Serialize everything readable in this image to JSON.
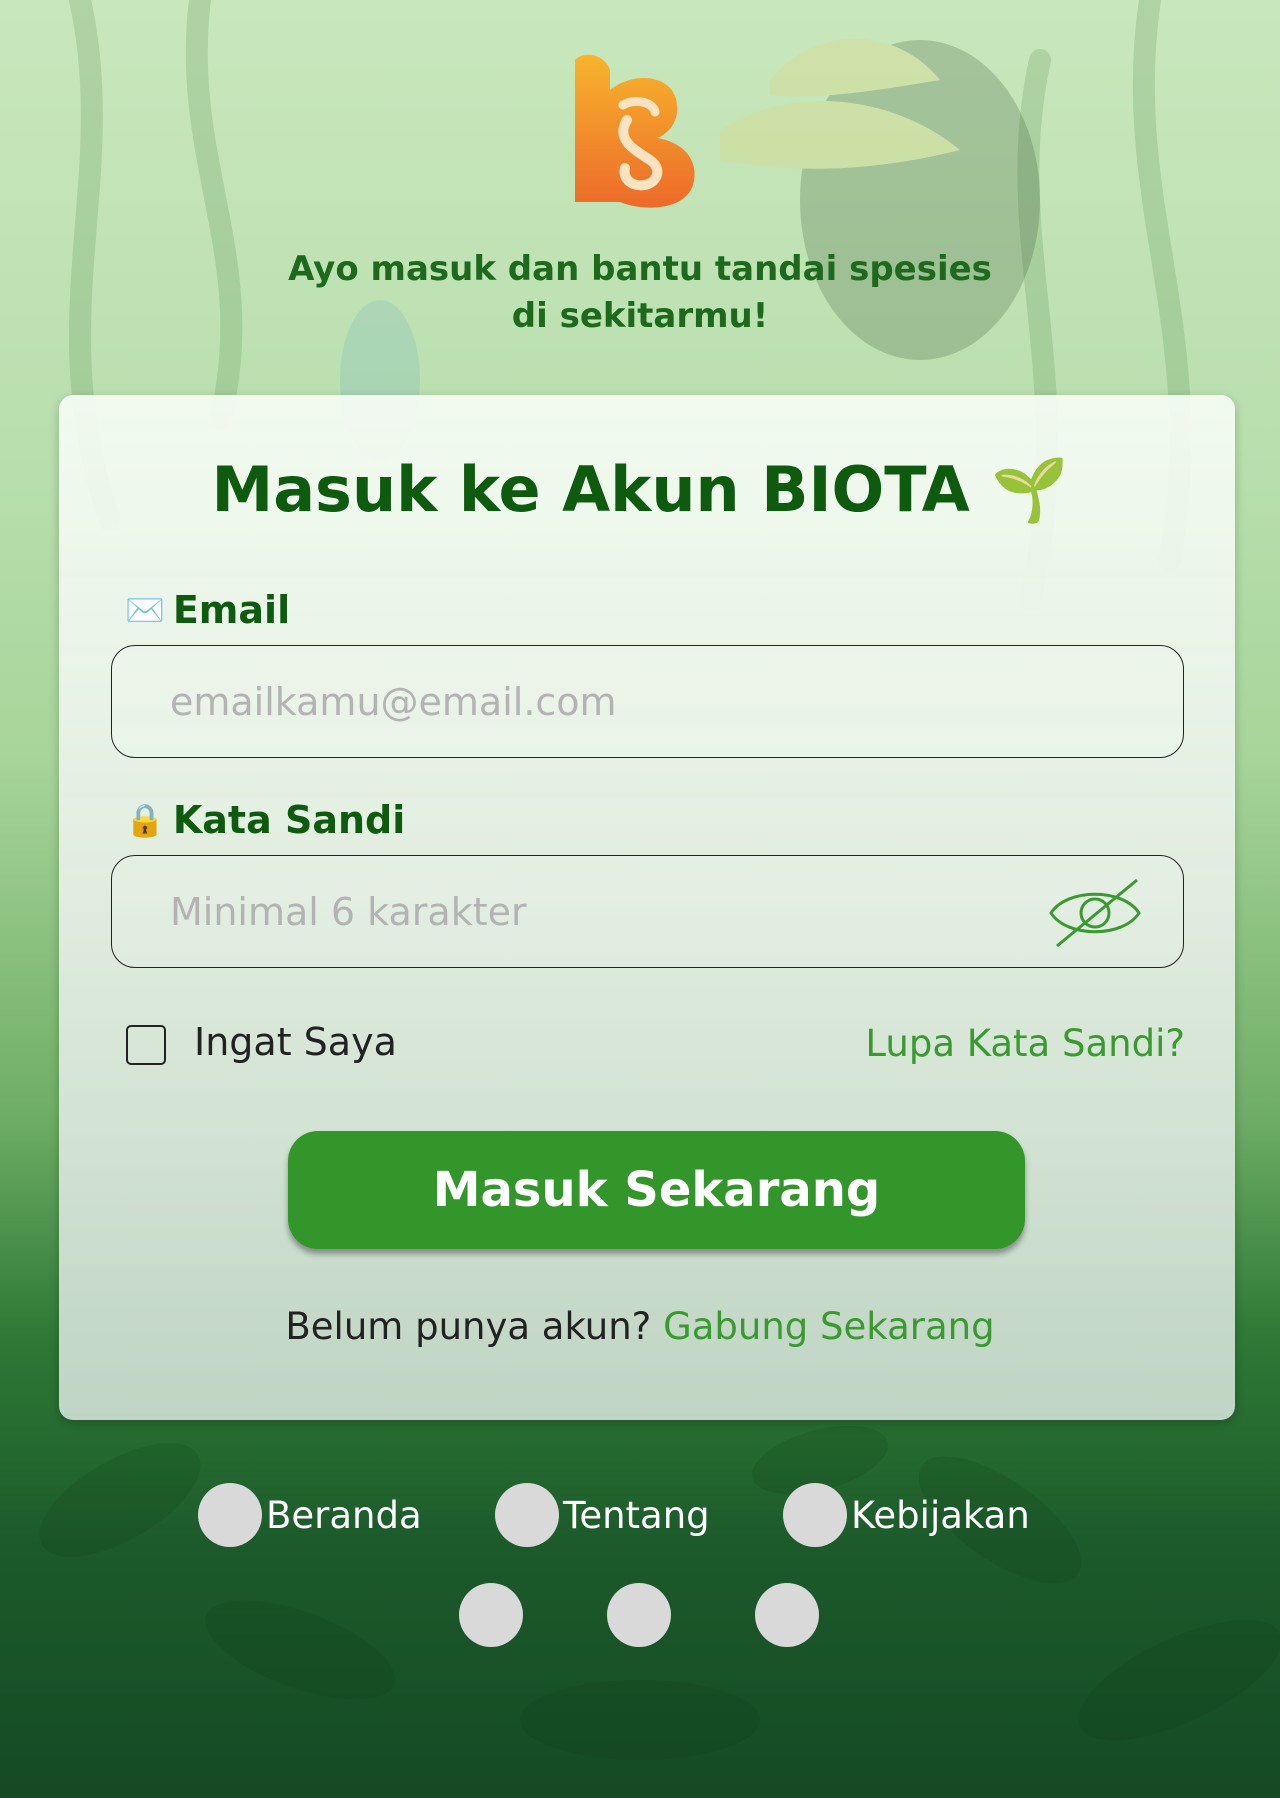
{
  "tagline": {
    "line1": "Ayo masuk dan bantu tandai spesies",
    "line2": "di sekitarmu!"
  },
  "form": {
    "title": "Masuk ke Akun BIOTA 🌱",
    "email": {
      "icon": "✉️",
      "label": "Email",
      "placeholder": "emailkamu@email.com"
    },
    "password": {
      "icon": "🔒",
      "label": "Kata Sandi",
      "placeholder": "Minimal 6 karakter"
    },
    "remember_label": "Ingat Saya",
    "forgot_label": "Lupa Kata Sandi?",
    "submit_label": "Masuk Sekarang",
    "signup_prompt": "Belum punya akun?",
    "signup_link": "Gabung Sekarang"
  },
  "footer": {
    "links": [
      "Beranda",
      "Tentang",
      "Kebijakan"
    ]
  },
  "colors": {
    "primary_green": "#33962a",
    "title_green": "#0e5a0e",
    "link_green": "#3a9a30",
    "logo_orange": "#f0902a"
  },
  "icons": {
    "logo": "biota-logo",
    "eye_toggle": "eye-off-icon"
  }
}
